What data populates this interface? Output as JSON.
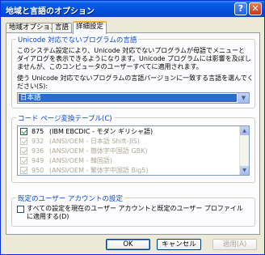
{
  "window": {
    "title": "地域と言語のオプション"
  },
  "titlebar": {
    "help_glyph": "?",
    "close_glyph": "✕"
  },
  "tabs": [
    {
      "label": "地域オプション"
    },
    {
      "label": "言語"
    },
    {
      "label": "詳細設定"
    }
  ],
  "unicode_group": {
    "title": "Unicode 対応でないプログラムの言語",
    "description": "このシステム設定により、Unicode 対応でないプログラムが母語でメニューとダイアログを表示できるようになります。Unicode プログラムには影響を及ぼしませんが、このコンピュータのユーザーすべてに適用されます。",
    "select_label": "使う Unicode 対応でないプログラムの言語バージョンに一致する言語を選んでください(S):",
    "selected_value": "日本語",
    "dropdown_glyph": "▼"
  },
  "codepage_group": {
    "title": "コード ページ変換テーブル(C)",
    "items": [
      {
        "code": "875",
        "name": "(IBM EBCDIC - モダン ギリシャ語)",
        "checked": true,
        "enabled": true
      },
      {
        "code": "932",
        "name": "(ANSI/OEM - 日本語 Shift-JIS)",
        "checked": true,
        "enabled": false
      },
      {
        "code": "936",
        "name": "(ANSI/OEM - 簡体字中国語 GBK)",
        "checked": true,
        "enabled": false
      },
      {
        "code": "949",
        "name": "(ANSI/OEM - 韓国語)",
        "checked": true,
        "enabled": false
      },
      {
        "code": "950",
        "name": "(ANSI/OEM - 繁体字中国語 Big5)",
        "checked": true,
        "enabled": false
      }
    ],
    "scroll_up_glyph": "▲",
    "scroll_down_glyph": "▼"
  },
  "default_user_group": {
    "title": "既定のユーザー アカウントの設定",
    "checkbox_label": "すべての設定を現在のユーザー アカウントと既定のユーザー プロファイルに適用する(D)",
    "checked": false
  },
  "buttons": {
    "ok": "OK",
    "cancel": "キャンセル",
    "apply": "適用(A)"
  }
}
